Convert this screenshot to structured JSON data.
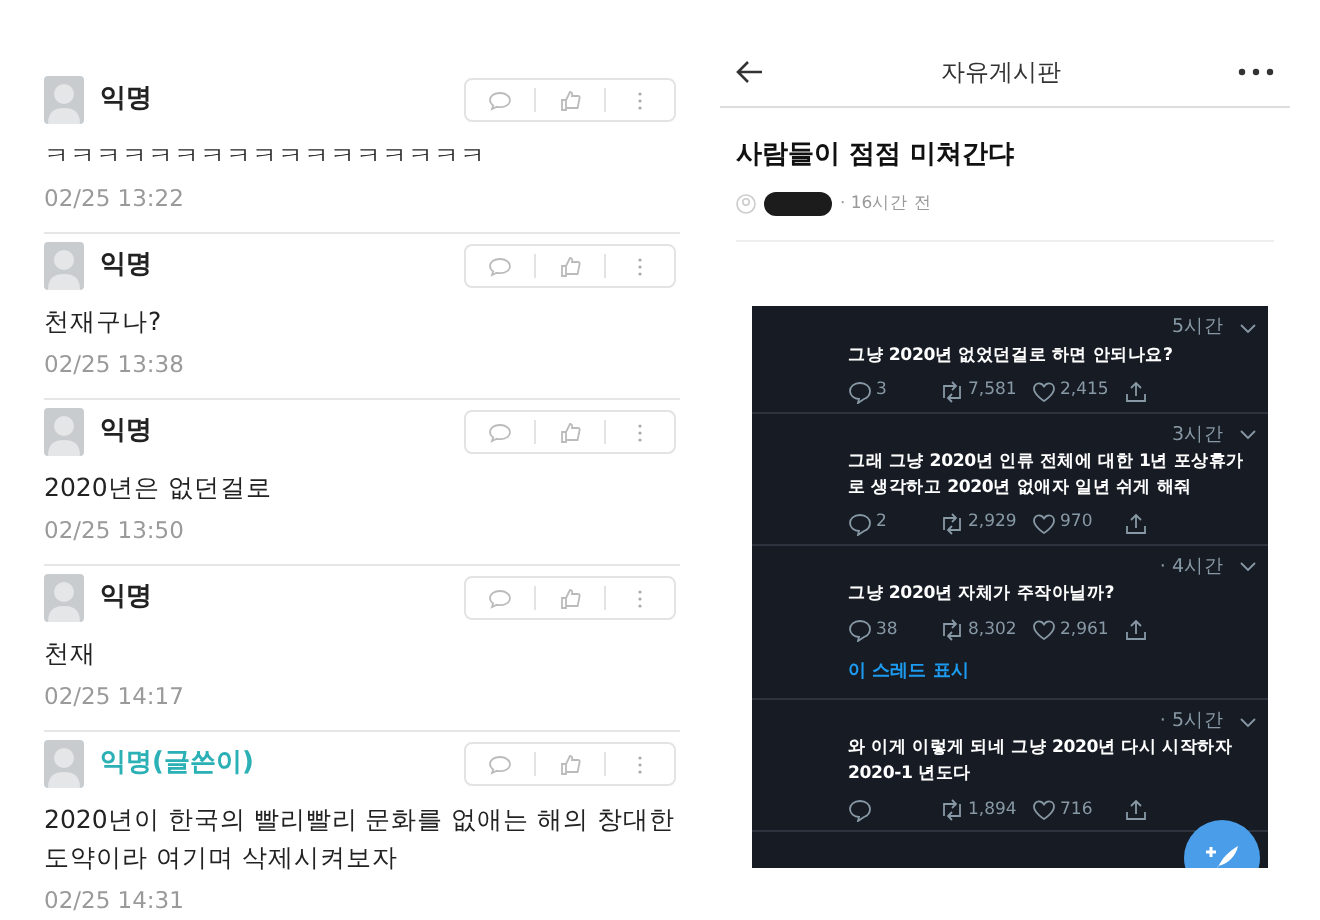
{
  "comments_screen": {
    "comments": [
      {
        "author": "익명",
        "is_writer": false,
        "text": "ㅋㅋㅋㅋㅋㅋㅋㅋㅋㅋㅋㅋㅋㅋㅋㅋㅋ",
        "time": "02/25 13:22"
      },
      {
        "author": "익명",
        "is_writer": false,
        "text": "천재구나?",
        "time": "02/25 13:38"
      },
      {
        "author": "익명",
        "is_writer": false,
        "text": "2020년은 없던걸로",
        "time": "02/25 13:50"
      },
      {
        "author": "익명",
        "is_writer": false,
        "text": "천재",
        "time": "02/25 14:17"
      },
      {
        "author": "익명(글쓴이)",
        "is_writer": true,
        "text": "2020년이 한국의 빨리빨리 문화를 없애는 해의 창대한 도약이라 여기며 삭제시켜보자",
        "time": "02/25 14:31"
      }
    ]
  },
  "board_screen": {
    "header": {
      "title": "자유게시판"
    },
    "post": {
      "title": "사람들이 점점 미쳐간댜",
      "time": "· 16시간 전"
    },
    "tweets": [
      {
        "time": "5시간",
        "text": "그냥 2020년 없었던걸로 하면 안되나요?",
        "replies": "3",
        "retweets": "7,581",
        "likes": "2,415"
      },
      {
        "time": "3시간",
        "text": "그래 그냥 2020년 인류 전체에 대한 1년 포상휴가로 생각하고 2020년 없애자 일년 쉬게 해줘",
        "replies": "2",
        "retweets": "2,929",
        "likes": "970"
      },
      {
        "time": "· 4시간",
        "text": "그냥 2020년 자체가 주작아닐까?",
        "replies": "38",
        "retweets": "8,302",
        "likes": "2,961",
        "thread_link": "이 스레드 표시"
      },
      {
        "time": "· 5시간",
        "text": "와 이게 이렇게 되네 그냥 2020년 다시 시작하자 2020-1 년도다",
        "retweets": "1,894",
        "likes": "716"
      }
    ]
  }
}
